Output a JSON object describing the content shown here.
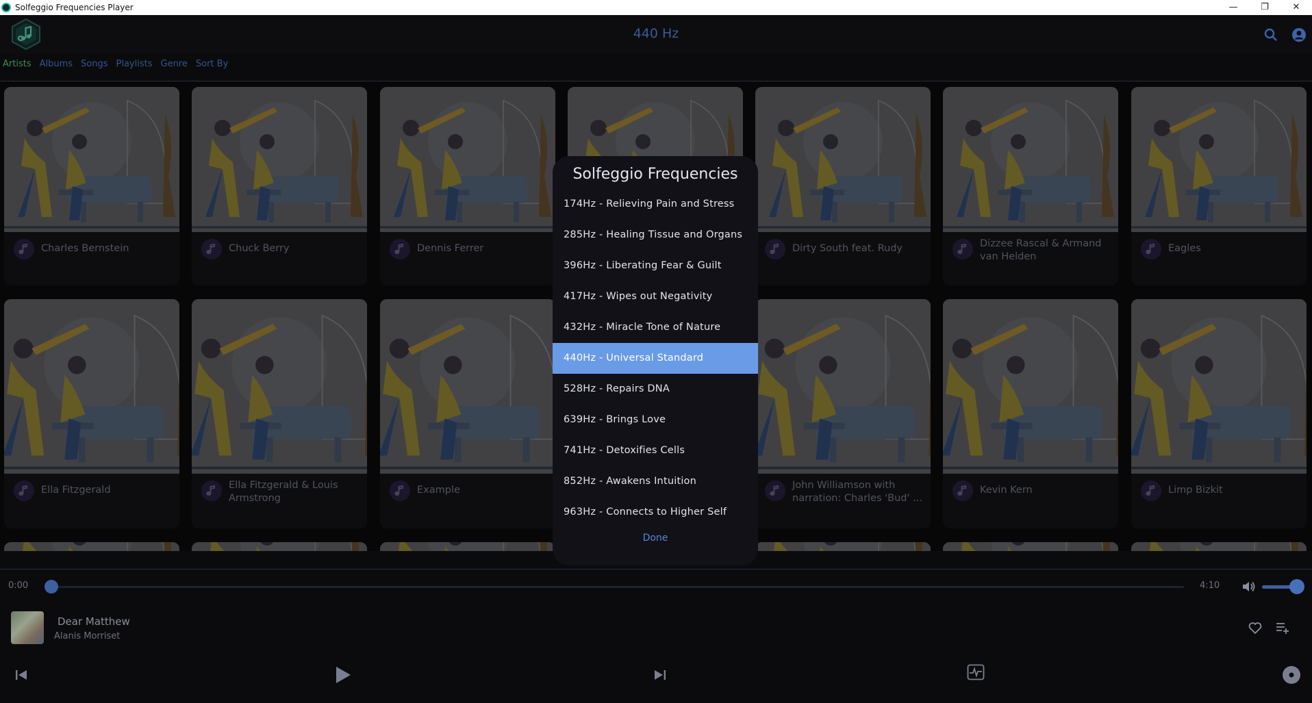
{
  "window": {
    "title": "Solfeggio Frequencies Player",
    "controls": [
      "—",
      "❐",
      "✕"
    ]
  },
  "header": {
    "title": "440 Hz"
  },
  "nav": {
    "tabs": [
      "Artists",
      "Albums",
      "Songs",
      "Playlists",
      "Genre",
      "Sort By"
    ],
    "active": "Artists"
  },
  "artists": {
    "row1": [
      "Charles Bernstein",
      "Chuck Berry",
      "Dennis Ferrer",
      "",
      "Dirty South feat. Rudy",
      "Dizzee Rascal & Armand van Helden",
      "Eagles"
    ],
    "row2": [
      "Ella Fitzgerald",
      "Ella Fitzgerald & Louis Armstrong",
      "Example",
      "",
      "John Williamson with narration: Charles 'Bud' ...",
      "Kevin Kern",
      "Limp Bizkit"
    ]
  },
  "modal": {
    "title": "Solfeggio Frequencies",
    "items": [
      "174Hz - Relieving Pain and Stress",
      "285Hz - Healing Tissue and Organs",
      "396Hz - Liberating Fear & Guilt",
      "417Hz - Wipes out Negativity",
      "432Hz - Miracle Tone of Nature",
      "440Hz - Universal Standard",
      "528Hz - Repairs DNA",
      "639Hz - Brings Love",
      "741Hz - Detoxifies Cells",
      "852Hz - Awakens Intuition",
      "963Hz - Connects to Higher Self"
    ],
    "selected_index": 5,
    "done_label": "Done"
  },
  "player": {
    "current_time": "0:00",
    "total_time": "4:10",
    "progress": 0,
    "volume": 1.0,
    "track_title": "Dear Matthew",
    "track_artist": "Alanis Morriset"
  },
  "colors": {
    "accent": "#3e5fa0",
    "selected": "#6a9be6",
    "active_tab": "#3c8f55"
  }
}
